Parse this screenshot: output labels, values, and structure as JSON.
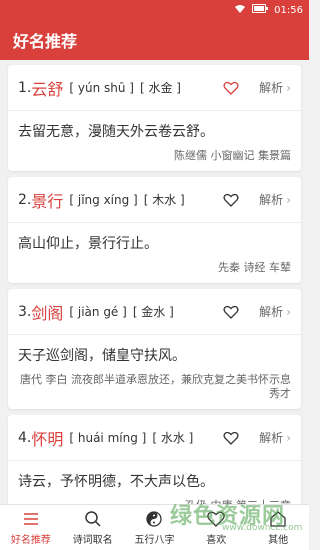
{
  "status": {
    "time": "01:56"
  },
  "header": {
    "title": "好名推荐"
  },
  "cards": [
    {
      "num": "1.",
      "name": "云舒",
      "pinyin": "[ yún shū ]",
      "wuxing": "[ 水金 ]",
      "jiexi": "解析",
      "verse": "去留无意，漫随天外云卷云舒。",
      "source": "陈继儒 小窗幽记 集景篇"
    },
    {
      "num": "2.",
      "name": "景行",
      "pinyin": "[ jǐng xíng ]",
      "wuxing": "[ 木水 ]",
      "jiexi": "解析",
      "verse": "高山仰止，景行行止。",
      "source": "先秦 诗经 车辇"
    },
    {
      "num": "3.",
      "name": "剑阁",
      "pinyin": "[ jiàn gé ]",
      "wuxing": "[ 金水 ]",
      "jiexi": "解析",
      "verse": "天子巡剑阁，储皇守扶风。",
      "source": "唐代 李白 流夜郎半道承恩放还，兼欣克复之美书怀示息秀才"
    },
    {
      "num": "4.",
      "name": "怀明",
      "pinyin": "[ huái míng ]",
      "wuxing": "[ 水水 ]",
      "jiexi": "解析",
      "verse": "诗云，予怀明德，不大声以色。",
      "source": "孔伋 中庸 第三十三章"
    }
  ],
  "tabs": [
    {
      "label": "好名推荐",
      "icon": "list-icon",
      "active": true
    },
    {
      "label": "诗词取名",
      "icon": "search-icon"
    },
    {
      "label": "五行八字",
      "icon": "yinyang-icon"
    },
    {
      "label": "喜欢",
      "icon": "heart-icon"
    },
    {
      "label": "其他",
      "icon": "home-icon"
    }
  ],
  "watermark": {
    "text": "绿色资源网",
    "url": "www.downcc.com"
  },
  "colors": {
    "primary": "#d9403c"
  }
}
